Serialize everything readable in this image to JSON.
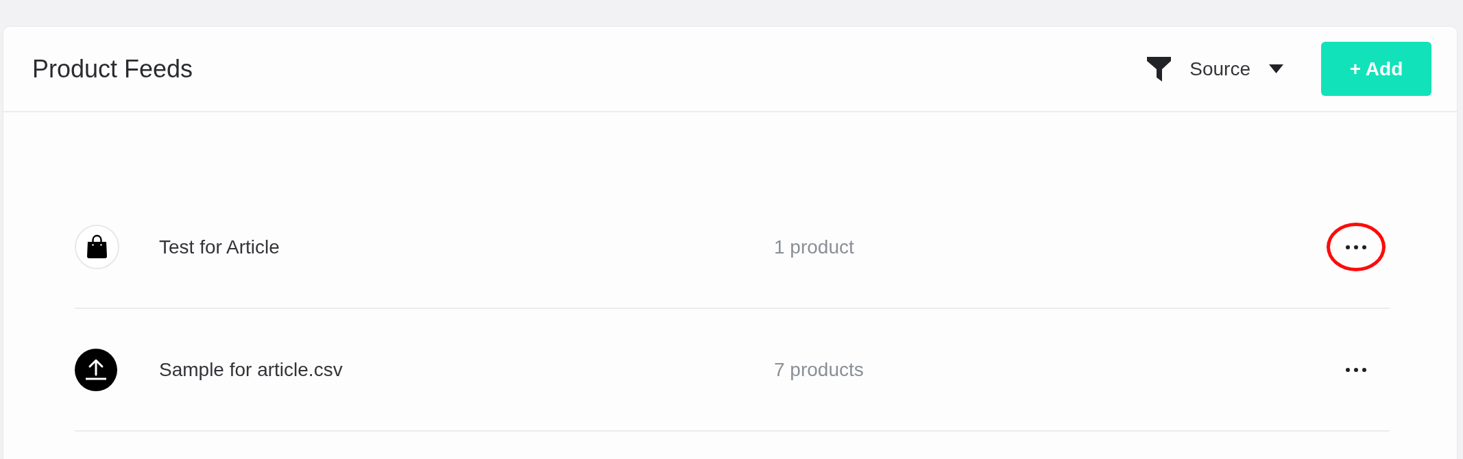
{
  "header": {
    "title": "Product Feeds",
    "filter": {
      "label": "Source"
    },
    "add_button": {
      "label": "+ Add"
    }
  },
  "feeds": [
    {
      "kind": "shop",
      "name": "Test for Article",
      "count": "1 product",
      "highlighted": true
    },
    {
      "kind": "upload",
      "name": "Sample for article.csv",
      "count": "7 products",
      "highlighted": false
    }
  ]
}
